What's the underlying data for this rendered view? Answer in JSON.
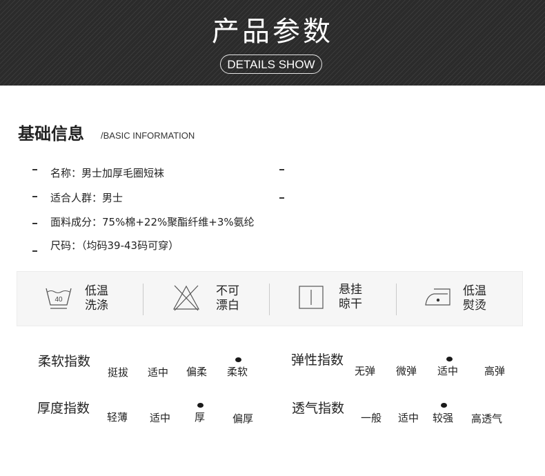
{
  "banner": {
    "title": "产品参数",
    "subtitle": "DETAILS SHOW"
  },
  "basic_info": {
    "title": "基础信息",
    "subtitle": "/BASIC INFORMATION",
    "items": [
      "名称：男士加厚毛圈短袜",
      "适合人群：男士",
      "面料成分：75%棉+22%聚酯纤维+3%氨纶",
      "尺码：（均码39-43码可穿）"
    ]
  },
  "care": [
    {
      "icon": "wash-40-icon",
      "label": "低温\n洗涤",
      "temperature": "40"
    },
    {
      "icon": "no-bleach-icon",
      "label": "不可\n漂白"
    },
    {
      "icon": "hang-dry-icon",
      "label": "悬挂\n晾干"
    },
    {
      "icon": "iron-low-icon",
      "label": "低温\n熨烫"
    }
  ],
  "indices": [
    {
      "title": "柔软指数",
      "options": [
        "挺拔",
        "适中",
        "偏柔",
        "柔软"
      ],
      "selected": "柔软"
    },
    {
      "title": "弹性指数",
      "options": [
        "无弹",
        "微弹",
        "适中",
        "高弹"
      ],
      "selected": "适中"
    },
    {
      "title": "厚度指数",
      "options": [
        "轻薄",
        "适中",
        "厚",
        "偏厚"
      ],
      "selected": "厚"
    },
    {
      "title": "透气指数",
      "options": [
        "一般",
        "适中",
        "较强",
        "高透气"
      ],
      "selected": "较强"
    }
  ]
}
